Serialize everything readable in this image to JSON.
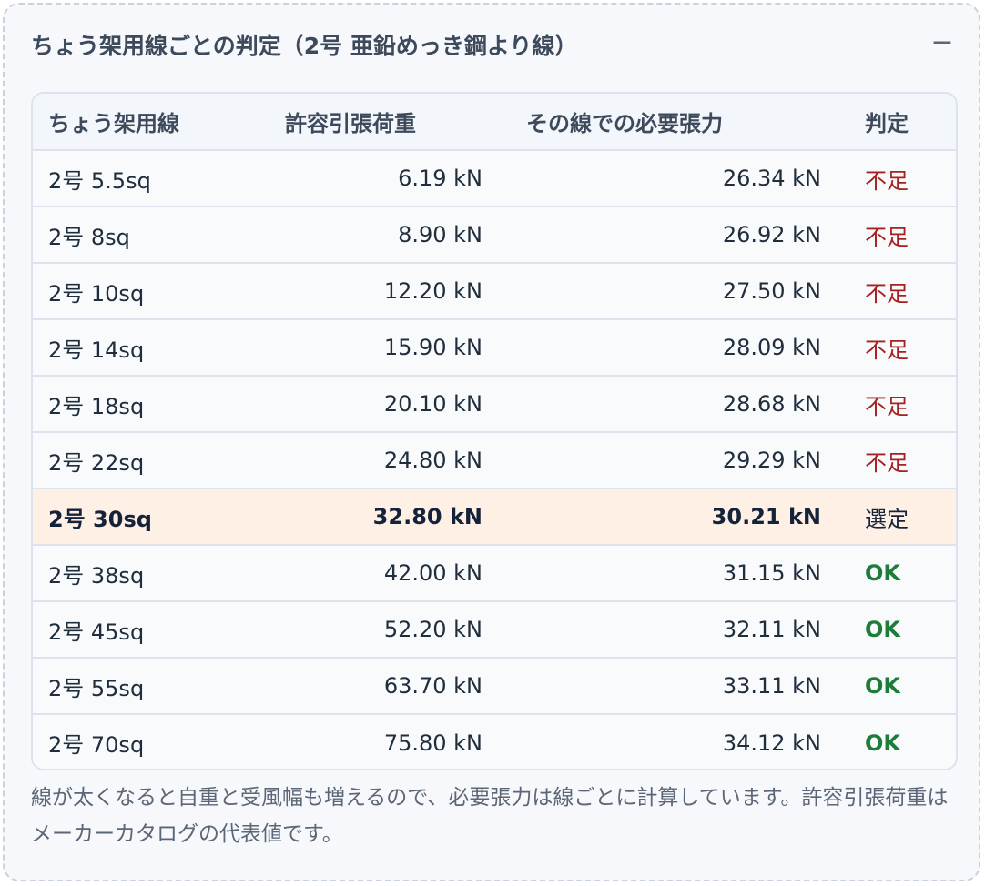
{
  "panel": {
    "title": "ちょう架用線ごとの判定（2号 亜鉛めっき鋼より線）",
    "collapse_symbol": "−"
  },
  "table": {
    "headers": {
      "wire": "ちょう架用線",
      "allowable": "許容引張荷重",
      "required": "その線での必要張力",
      "judgement": "判定"
    },
    "rows": [
      {
        "wire": "2号 5.5sq",
        "allowable": "6.19 kN",
        "required": "26.34 kN",
        "judgement": "不足",
        "status": "short"
      },
      {
        "wire": "2号 8sq",
        "allowable": "8.90 kN",
        "required": "26.92 kN",
        "judgement": "不足",
        "status": "short"
      },
      {
        "wire": "2号 10sq",
        "allowable": "12.20 kN",
        "required": "27.50 kN",
        "judgement": "不足",
        "status": "short"
      },
      {
        "wire": "2号 14sq",
        "allowable": "15.90 kN",
        "required": "28.09 kN",
        "judgement": "不足",
        "status": "short"
      },
      {
        "wire": "2号 18sq",
        "allowable": "20.10 kN",
        "required": "28.68 kN",
        "judgement": "不足",
        "status": "short"
      },
      {
        "wire": "2号 22sq",
        "allowable": "24.80 kN",
        "required": "29.29 kN",
        "judgement": "不足",
        "status": "short"
      },
      {
        "wire": "2号 30sq",
        "allowable": "32.80 kN",
        "required": "30.21 kN",
        "judgement": "選定",
        "status": "selected"
      },
      {
        "wire": "2号 38sq",
        "allowable": "42.00 kN",
        "required": "31.15 kN",
        "judgement": "OK",
        "status": "ok"
      },
      {
        "wire": "2号 45sq",
        "allowable": "52.20 kN",
        "required": "32.11 kN",
        "judgement": "OK",
        "status": "ok"
      },
      {
        "wire": "2号 55sq",
        "allowable": "63.70 kN",
        "required": "33.11 kN",
        "judgement": "OK",
        "status": "ok"
      },
      {
        "wire": "2号 70sq",
        "allowable": "75.80 kN",
        "required": "34.12 kN",
        "judgement": "OK",
        "status": "ok"
      }
    ]
  },
  "footnote": "線が太くなると自重と受風幅も増えるので、必要張力は線ごとに計算しています。許容引張荷重はメーカーカタログの代表値です。",
  "colors": {
    "short": "#a52121",
    "ok": "#1e7c3a",
    "selected_row_bg": "#fff0e6"
  }
}
